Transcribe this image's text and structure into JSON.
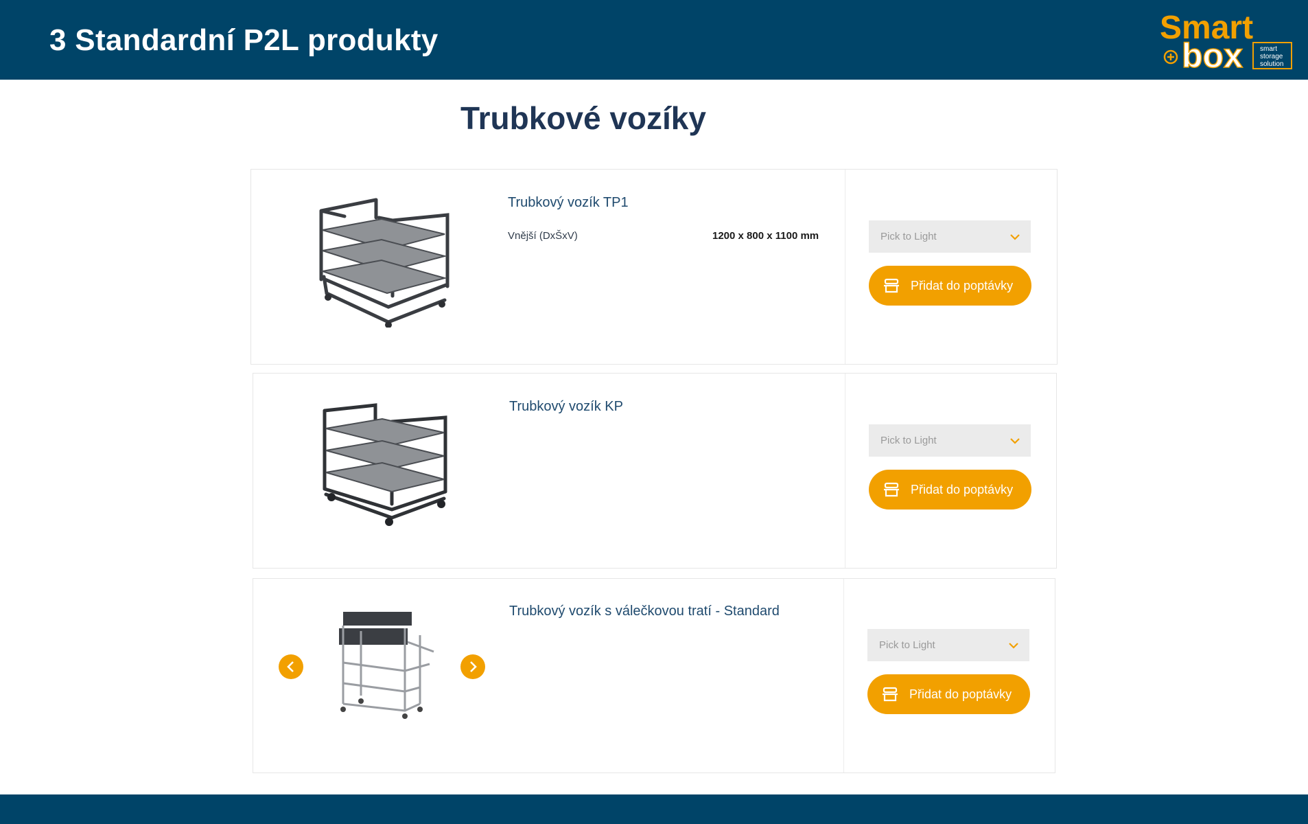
{
  "header": {
    "title": "3 Standardní P2L produkty",
    "logo": {
      "word1": "Smart",
      "word2": "box",
      "tagline": [
        "smart",
        "storage",
        "solution"
      ]
    }
  },
  "section": {
    "title": "Trubkové vozíky"
  },
  "products": [
    {
      "name": "Trubkový vozík TP1",
      "spec_label": "Vnější (DxŠxV)",
      "spec_value": "1200 x 800 x 1100 mm",
      "select_value": "Pick to Light",
      "button_label": "Přidat do poptávky"
    },
    {
      "name": "Trubkový vozík KP",
      "select_value": "Pick to Light",
      "button_label": "Přidat do poptávky"
    },
    {
      "name": "Trubkový vozík s válečkovou tratí - Standard",
      "select_value": "Pick to Light",
      "button_label": "Přidat do poptávky"
    }
  ],
  "colors": {
    "header_bg": "#004468",
    "accent": "#f2a000",
    "title_text": "#1f3555",
    "select_bg": "#ebebeb"
  },
  "icons": [
    "chevron-down-icon",
    "cart-icon",
    "arrow-left-icon",
    "arrow-right-icon"
  ]
}
